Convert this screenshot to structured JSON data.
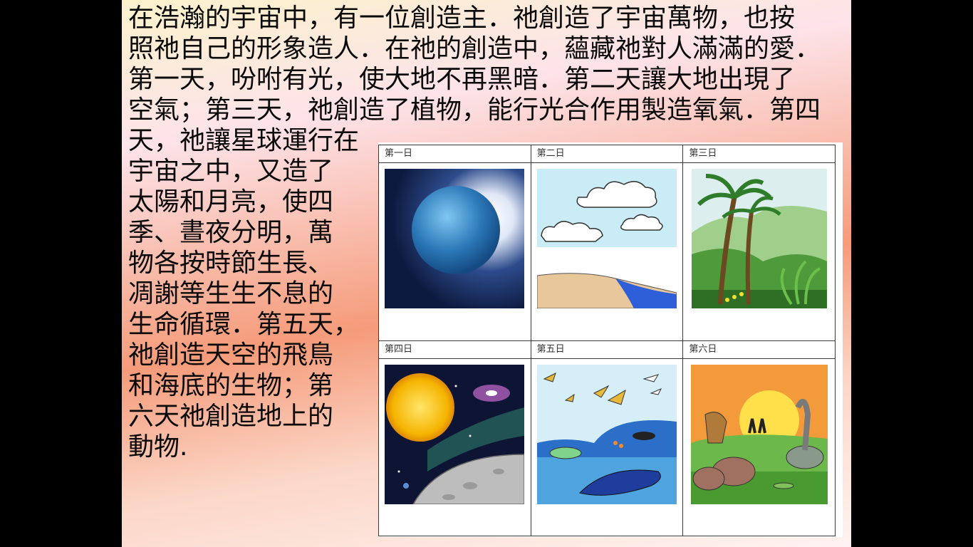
{
  "paragraph": {
    "lines": [
      "在浩瀚的宇宙中，有一位創造主．祂創造了宇宙萬物，也按",
      "照祂自己的形象造人．在祂的創造中，蘊藏祂對人滿滿的愛．",
      "第一天，吩咐有光，使大地不再黑暗．第二天讓大地出現了",
      "空氣；第三天，祂創造了植物，能行光合作用製造氧氣．第四",
      "天，祂讓星球運行在",
      "宇宙之中，又造了",
      "太陽和月亮，使四",
      "季、晝夜分明，萬",
      "物各按時節生長、",
      "凋謝等生生不息的",
      "生命循環．第五天，",
      "祂創造天空的飛鳥",
      "和海底的生物；第",
      "六天祂創造地上的",
      "動物."
    ]
  },
  "days": [
    {
      "label": "第一日",
      "picture": "blue-planet"
    },
    {
      "label": "第二日",
      "picture": "sky-clouds-water"
    },
    {
      "label": "第三日",
      "picture": "palm-trees-hills"
    },
    {
      "label": "第四日",
      "picture": "sun-moon-galaxy"
    },
    {
      "label": "第五日",
      "picture": "birds-sea-creatures"
    },
    {
      "label": "第六日",
      "picture": "sunset-animals-people"
    }
  ],
  "colors": {
    "slide_top": "#fbf2cc",
    "slide_middle": "#f59b7a",
    "text": "#0a0a0a"
  }
}
